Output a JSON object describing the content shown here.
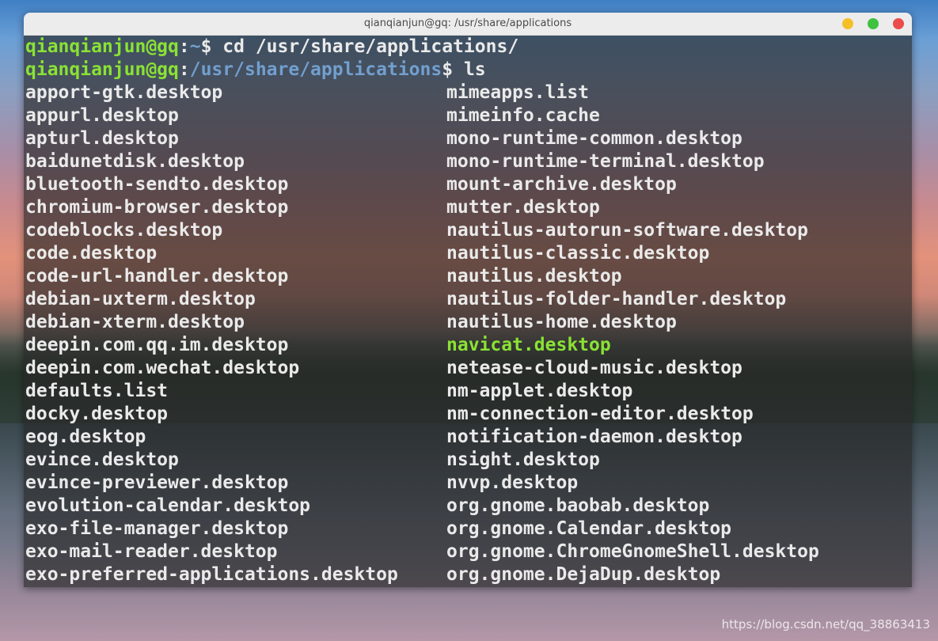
{
  "window": {
    "title": "qianqianjun@gq: /usr/share/applications"
  },
  "terminal": {
    "lines": [
      {
        "user": "qianqianjun@gq",
        "sep": ":",
        "path": "~",
        "prompt": "$ ",
        "cmd": "cd /usr/share/applications/"
      },
      {
        "user": "qianqianjun@gq",
        "sep": ":",
        "path": "/usr/share/applications",
        "prompt": "$ ",
        "cmd": "ls"
      }
    ],
    "left_column": [
      "apport-gtk.desktop",
      "appurl.desktop",
      "apturl.desktop",
      "baidunetdisk.desktop",
      "bluetooth-sendto.desktop",
      "chromium-browser.desktop",
      "codeblocks.desktop",
      "code.desktop",
      "code-url-handler.desktop",
      "debian-uxterm.desktop",
      "debian-xterm.desktop",
      "deepin.com.qq.im.desktop",
      "deepin.com.wechat.desktop",
      "defaults.list",
      "docky.desktop",
      "eog.desktop",
      "evince.desktop",
      "evince-previewer.desktop",
      "evolution-calendar.desktop",
      "exo-file-manager.desktop",
      "exo-mail-reader.desktop",
      "exo-preferred-applications.desktop"
    ],
    "right_column": [
      "mimeapps.list",
      "mimeinfo.cache",
      "mono-runtime-common.desktop",
      "mono-runtime-terminal.desktop",
      "mount-archive.desktop",
      "mutter.desktop",
      "nautilus-autorun-software.desktop",
      "nautilus-classic.desktop",
      "nautilus.desktop",
      "nautilus-folder-handler.desktop",
      "nautilus-home.desktop",
      "navicat.desktop",
      "netease-cloud-music.desktop",
      "nm-applet.desktop",
      "nm-connection-editor.desktop",
      "notification-daemon.desktop",
      "nsight.desktop",
      "nvvp.desktop",
      "org.gnome.baobab.desktop",
      "org.gnome.Calendar.desktop",
      "org.gnome.ChromeGnomeShell.desktop",
      "org.gnome.DejaDup.desktop"
    ]
  },
  "watermark": "https://blog.csdn.net/qq_38863413",
  "colors": {
    "user_prompt": "#8ae234",
    "path": "#729fcf",
    "executable": "#8ae234",
    "text": "#eaeaea"
  }
}
